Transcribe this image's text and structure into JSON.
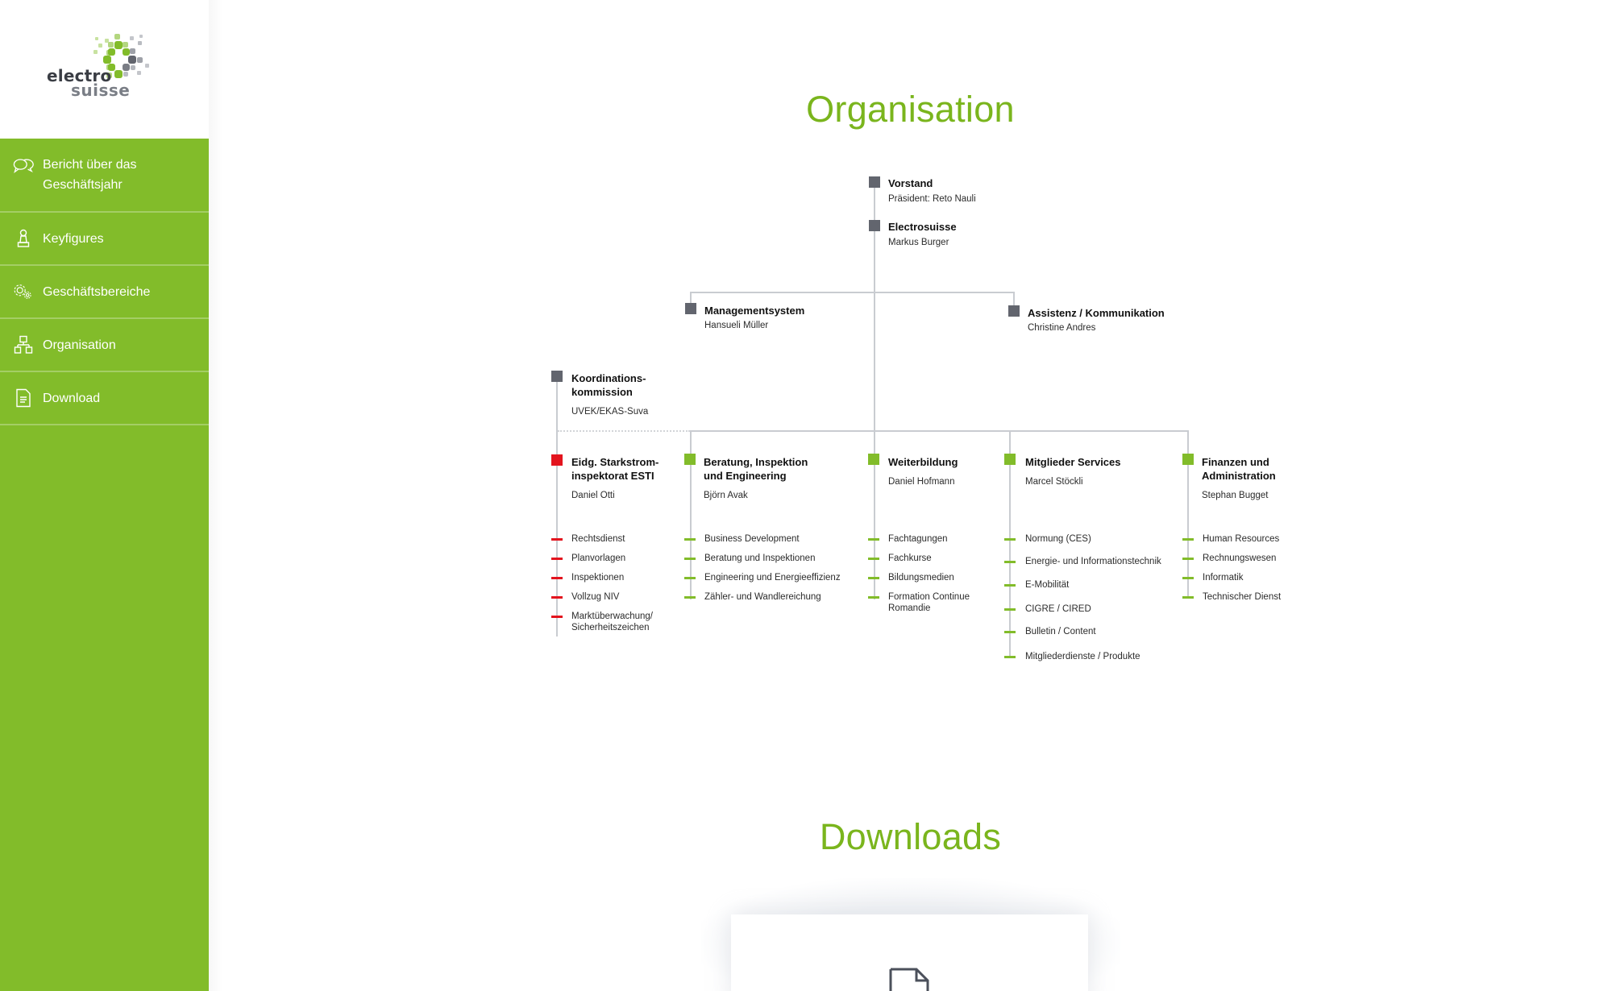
{
  "brand": {
    "line1": "electro",
    "line2": "suisse",
    "colors": {
      "green": "#82bc2a",
      "title_green": "#7ab51d",
      "red": "#e3141e",
      "gray_square": "#62656e",
      "connector": "#c9ccd1"
    }
  },
  "sidebar": {
    "items": [
      {
        "label": "Bericht über das Geschäftsjahr",
        "icon": "chat-bubbles-icon"
      },
      {
        "label": "Keyfigures",
        "icon": "chess-pawn-icon"
      },
      {
        "label": "Geschäftsbereiche",
        "icon": "gears-icon"
      },
      {
        "label": "Organisation",
        "icon": "org-chart-icon"
      },
      {
        "label": "Download",
        "icon": "document-icon"
      }
    ]
  },
  "organisation": {
    "title": "Organisation",
    "top": [
      {
        "title": "Vorstand",
        "sub": "Präsident: Reto Nauli"
      },
      {
        "title": "Electrosuisse",
        "sub": "Markus Burger"
      }
    ],
    "staff": [
      {
        "title": "Managementsystem",
        "sub": "Hansueli Müller"
      },
      {
        "title": "Assistenz / Kommunikation",
        "sub": "Christine Andres"
      }
    ],
    "coordination": {
      "title_line1": "Koordinations-",
      "title_line2": "kommission",
      "sub": "UVEK/EKAS-Suva"
    },
    "divisions": [
      {
        "title_line1": "Eidg. Starkstrom-",
        "title_line2": "inspektorat ESTI",
        "sub": "Daniel Otti",
        "color": "red",
        "items": [
          "Rechtsdienst",
          "Planvorlagen",
          "Inspektionen",
          "Vollzug NIV",
          "Marktüberwachung/",
          "Sicherheitszeichen"
        ]
      },
      {
        "title_line1": "Beratung, Inspektion",
        "title_line2": "und Engineering",
        "sub": "Björn Avak",
        "color": "green",
        "items": [
          "Business Development",
          "Beratung und Inspektionen",
          "Engineering und Energieeffizienz",
          "Zähler- und Wandlereichung"
        ]
      },
      {
        "title_line1": "Weiterbildung",
        "title_line2": "",
        "sub": "Daniel Hofmann",
        "color": "green",
        "items": [
          "Fachtagungen",
          "Fachkurse",
          "Bildungsmedien",
          "Formation Continue",
          "Romandie"
        ]
      },
      {
        "title_line1": "Mitglieder Services",
        "title_line2": "",
        "sub": "Marcel Stöckli",
        "color": "green",
        "items": [
          "Normung (CES)",
          "Energie- und Informationstechnik",
          "E-Mobilität",
          "CIGRE / CIRED",
          "Bulletin / Content",
          "Mitgliederdienste / Produkte"
        ]
      },
      {
        "title_line1": "Finanzen und",
        "title_line2": "Administration",
        "sub": "Stephan Bugget",
        "color": "green",
        "items": [
          "Human Resources",
          "Rechnungswesen",
          "Informatik",
          "Technischer Dienst"
        ]
      }
    ]
  },
  "downloads": {
    "title": "Downloads",
    "card_icon": "document-icon"
  }
}
